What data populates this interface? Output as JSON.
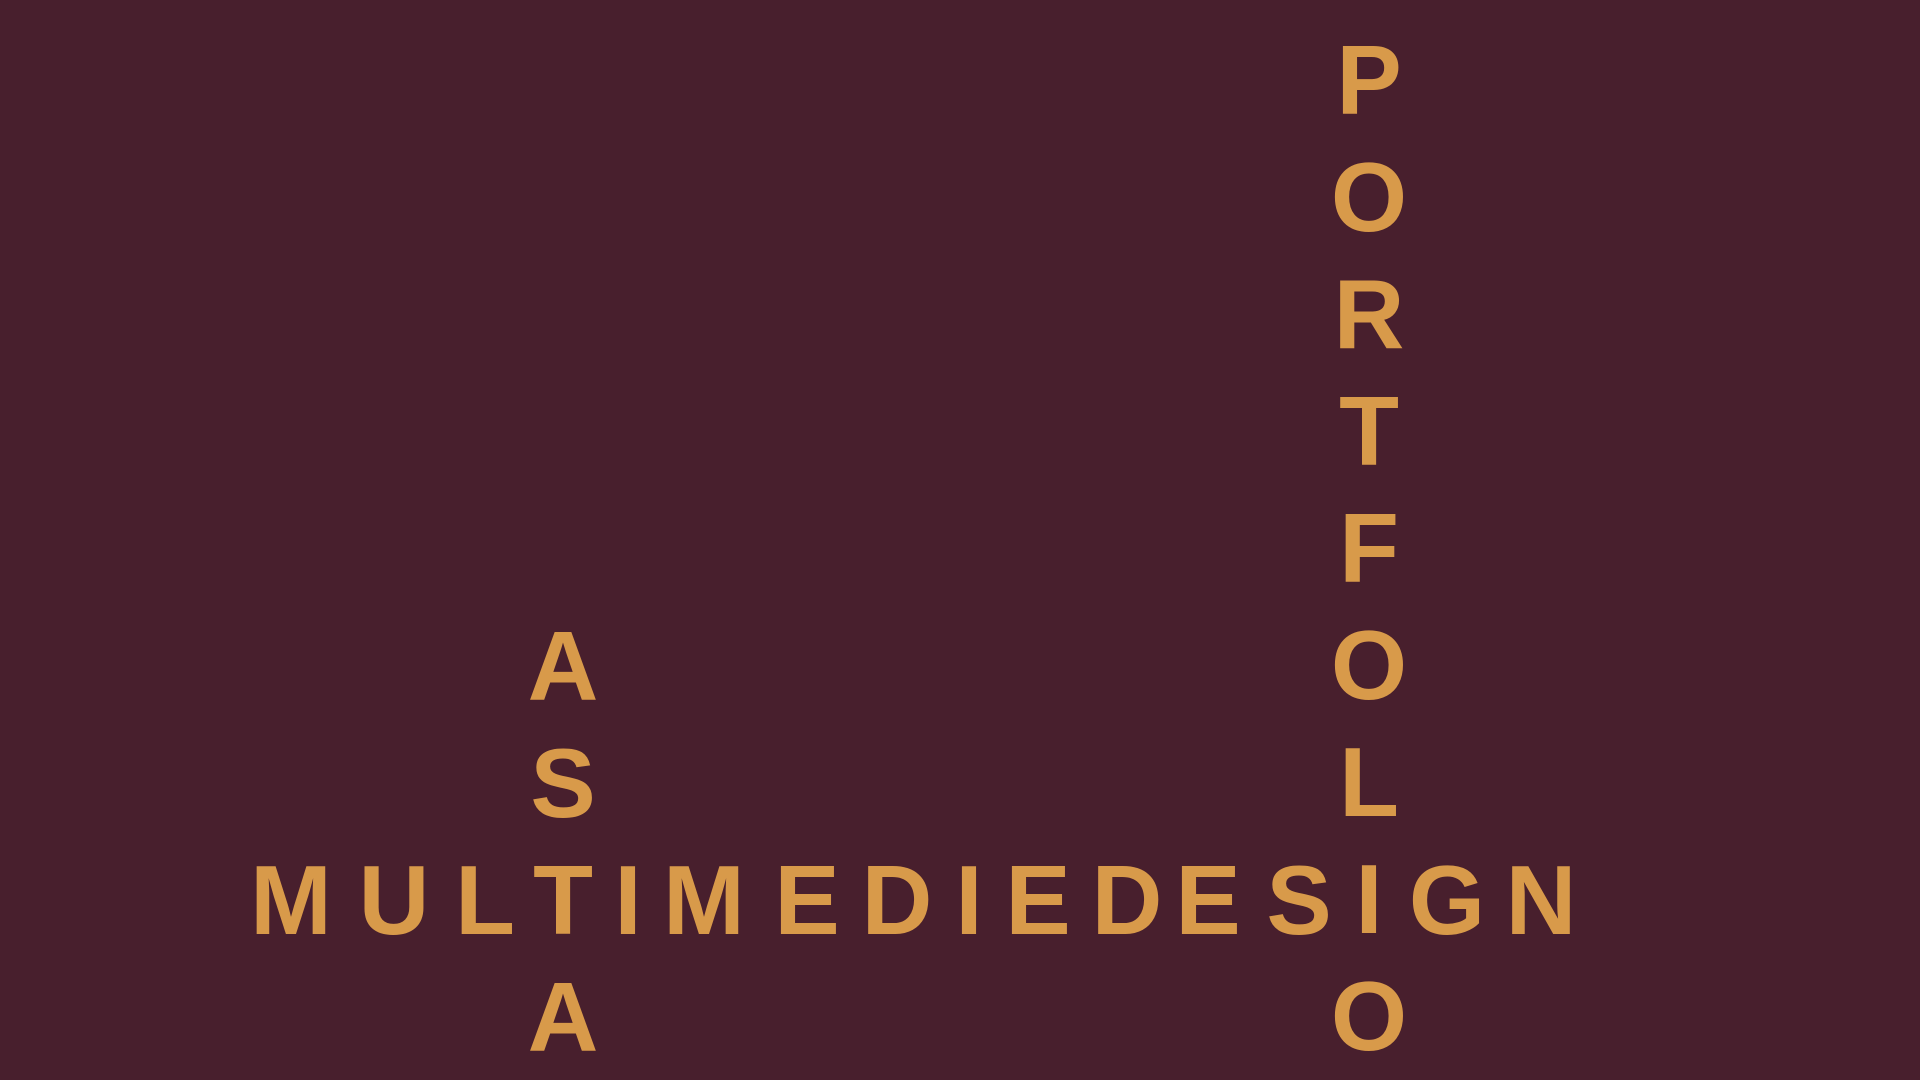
{
  "words": {
    "asta": {
      "text": "ASTA",
      "letters": [
        "A",
        "S",
        "T",
        "A"
      ]
    },
    "portfolio": {
      "text": "PORTFOLIO",
      "letters": [
        "P",
        "O",
        "R",
        "T",
        "F",
        "O",
        "L",
        "I",
        "O"
      ]
    },
    "multimediedesign": {
      "text": "MULTIMEDIEDESIGN",
      "letters": [
        "M",
        "U",
        "L",
        "T",
        "I",
        "M",
        "E",
        "D",
        "I",
        "E",
        "D",
        "E",
        "S",
        "I",
        "G",
        "N"
      ]
    }
  },
  "colors": {
    "background": "#481f2d",
    "text": "#d89a4a"
  }
}
